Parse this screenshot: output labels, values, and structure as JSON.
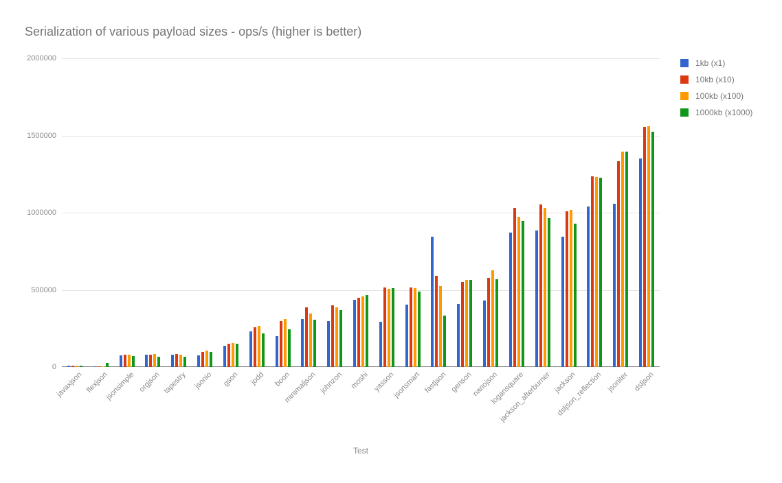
{
  "title": "Serialization of various payload sizes  - ops/s (higher is better)",
  "x_axis_title": "Test",
  "y_ticks": [
    0,
    500000,
    1000000,
    1500000,
    2000000
  ],
  "legend": [
    {
      "label": "1kb (x1)",
      "color": "#3366cc"
    },
    {
      "label": "10kb (x10)",
      "color": "#dc3912"
    },
    {
      "label": "100kb (x100)",
      "color": "#ff9900"
    },
    {
      "label": "1000kb (x1000)",
      "color": "#109618"
    }
  ],
  "chart_data": {
    "type": "bar",
    "title": "Serialization of various payload sizes  - ops/s (higher is better)",
    "xlabel": "Test",
    "ylabel": "",
    "ylim": [
      0,
      2000000
    ],
    "categories": [
      "javaxjson",
      "flexjson",
      "jsonsimple",
      "orgjson",
      "tapestry",
      "jsonio",
      "gson",
      "jodd",
      "boon",
      "minimaljson",
      "johnzon",
      "moshi",
      "yasson",
      "jsonsmart",
      "fastjson",
      "genson",
      "nanojson",
      "logansquare",
      "jackson_afterburner",
      "jackson",
      "dsljson_reflection",
      "jsoniter",
      "dsljson"
    ],
    "series": [
      {
        "name": "1kb (x1)",
        "values": [
          10000,
          5000,
          75000,
          80000,
          80000,
          75000,
          140000,
          230000,
          200000,
          310000,
          300000,
          435000,
          295000,
          405000,
          845000,
          410000,
          430000,
          870000,
          885000,
          845000,
          1040000,
          1060000,
          1350000
        ]
      },
      {
        "name": "10kb (x10)",
        "values": [
          10000,
          5000,
          80000,
          80000,
          85000,
          100000,
          150000,
          260000,
          300000,
          385000,
          400000,
          450000,
          515000,
          515000,
          590000,
          550000,
          580000,
          1030000,
          1055000,
          1010000,
          1235000,
          1335000,
          1555000
        ]
      },
      {
        "name": "100kb (x100)",
        "values": [
          10000,
          5000,
          80000,
          85000,
          80000,
          105000,
          155000,
          265000,
          310000,
          345000,
          385000,
          460000,
          505000,
          510000,
          525000,
          565000,
          625000,
          975000,
          1030000,
          1020000,
          1230000,
          1395000,
          1560000
        ]
      },
      {
        "name": "1000kb (x1000)",
        "values": [
          10000,
          25000,
          70000,
          65000,
          65000,
          100000,
          150000,
          220000,
          245000,
          305000,
          370000,
          465000,
          510000,
          490000,
          335000,
          565000,
          570000,
          945000,
          965000,
          930000,
          1225000,
          1395000,
          1525000
        ]
      }
    ]
  }
}
